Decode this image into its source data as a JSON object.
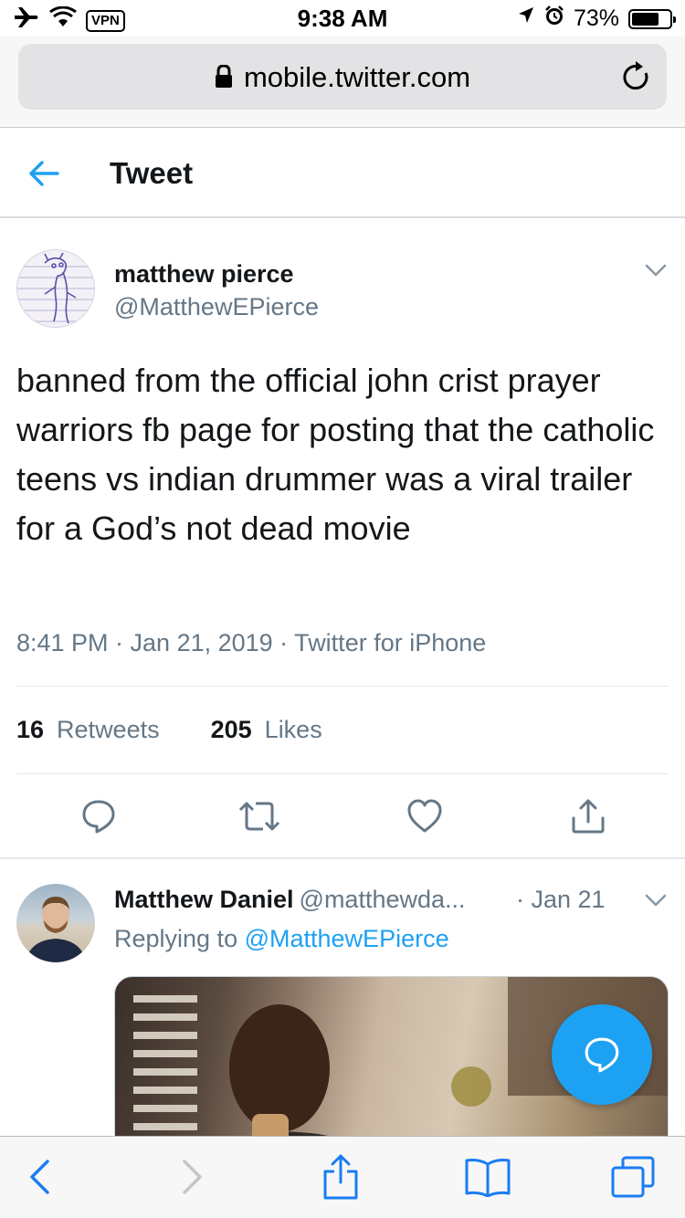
{
  "status_bar": {
    "vpn_label": "VPN",
    "time": "9:38 AM",
    "battery_percent": "73%",
    "battery_level": 0.73,
    "icons": [
      "airplane-icon",
      "wifi-icon",
      "location-icon",
      "alarm-icon",
      "battery-icon"
    ]
  },
  "browser": {
    "url": "mobile.twitter.com",
    "icons": [
      "lock-icon",
      "reload-icon"
    ]
  },
  "header": {
    "title": "Tweet",
    "back_icon": "back-arrow-icon"
  },
  "tweet": {
    "author_name": "matthew pierce",
    "author_handle": "@MatthewEPierce",
    "text": "banned from the official john crist prayer warriors fb page for posting that the catholic teens vs indian drummer was a viral trailer for a God’s not dead movie",
    "meta": "8:41 PM · Jan 21, 2019 · Twitter for iPhone",
    "retweets_count": "16",
    "retweets_label": "Retweets",
    "likes_count": "205",
    "likes_label": "Likes",
    "action_icons": [
      "reply-icon",
      "retweet-icon",
      "like-icon",
      "share-icon"
    ]
  },
  "reply": {
    "author_name": "Matthew Daniel",
    "author_handle": "@matthewda...",
    "date": "· Jan 21",
    "replying_prefix": "Replying to",
    "replying_to": "@MatthewEPierce"
  },
  "colors": {
    "accent": "#1da1f2",
    "text_primary": "#14171a",
    "text_secondary": "#657786",
    "divider": "#e1e8ed"
  },
  "toolbar": {
    "icons": [
      "safari-back-icon",
      "safari-forward-icon",
      "safari-share-icon",
      "bookmarks-icon",
      "tabs-icon"
    ]
  }
}
